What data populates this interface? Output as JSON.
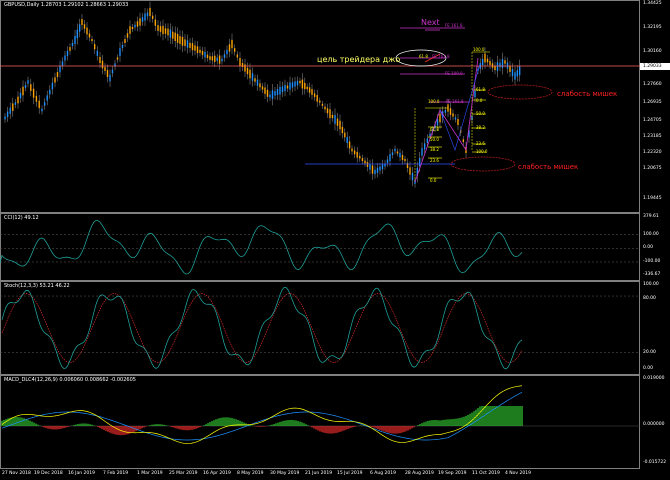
{
  "symbol_header": "GBPUSD,Daily  1.28703 1.29102 1.28663 1.29033",
  "indicators": {
    "cci": "CCI(12) 49.12",
    "stoch": "Stoch(12,3,3) 53.21 46.22",
    "macd": "MACD_DLC4(12,26,9) 0.006060 0.008662 -0.002605"
  },
  "price_axis": [
    "1.34425",
    "1.32195",
    "1.30160",
    "1.27660",
    "1.26935",
    "1.24705",
    "1.23185",
    "1.22320",
    "1.20675",
    "1.19445"
  ],
  "price_tag": "1.29033",
  "cci_axis": [
    "379.61",
    "100.00",
    "0.00",
    "-100.00",
    "-336.67"
  ],
  "stoch_axis": [
    "100.00",
    "80.00",
    "20.00",
    "0.00"
  ],
  "macd_axis": [
    "0.019000",
    "0.000000",
    "-0.015722"
  ],
  "dates": [
    "27 Nov 2018",
    "19 Dec 2018",
    "16 Jan 2019",
    "7 Feb 2019",
    "1 Mar 2019",
    "25 Mar 2019",
    "16 Apr 2019",
    "8 May 2019",
    "30 May 2019",
    "21 Jun 2019",
    "15 Jul 2019",
    "6 Aug 2019",
    "28 Aug 2019",
    "19 Sep 2019",
    "11 Oct 2019",
    "4 Nov 2019"
  ],
  "annotations": {
    "next": "Next",
    "trader_goal": "цель трейдера джо",
    "weakness_1": "слабость мишек",
    "weakness_2": "слабость мишек"
  },
  "fib_levels": {
    "top_100": "100.0",
    "top_fe1618": "FE 161.8",
    "top_fe1000": "FE 100.0",
    "top_fe1618b": "FE 161.8",
    "top_618": "61.8",
    "top_0": "0.0",
    "a_1000": "100.0",
    "a_fe1618": "FE 161.8",
    "a_618": "61.8",
    "a_50": "50.0",
    "a_382": "38.2",
    "a_236": "23.6",
    "a_0": "0.0",
    "b_100": "100.0",
    "b_618": "61.8",
    "b_50": "50.0",
    "b_382": "38.2",
    "b_236": "23.6",
    "b_0": "0.0"
  },
  "colors": {
    "bull": "#1e90ff",
    "bear": "#ffa500",
    "fib": "#ffff00",
    "fe": "#cc33cc",
    "hline": "#ff6666",
    "note": "#ff2020",
    "cci": "#20b2aa",
    "stoch_main": "#20b2aa",
    "stoch_signal": "#ff3030",
    "macd_pos": "#32cd32",
    "macd_neg": "#ff3030",
    "macd_main": "#ffff00",
    "macd_signal": "#1e90ff"
  }
}
